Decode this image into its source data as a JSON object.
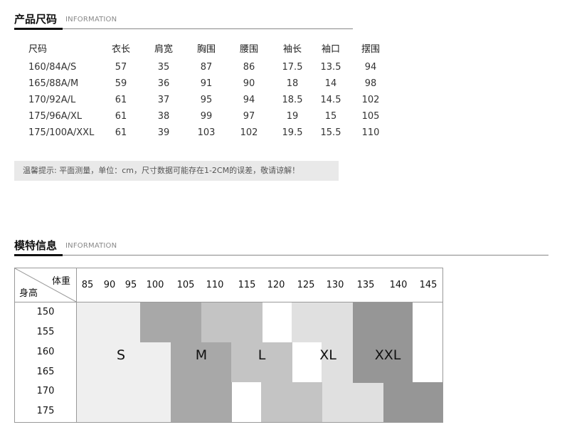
{
  "section1": {
    "title": "产品尺码",
    "subtitle": "INFORMATION"
  },
  "size_table": {
    "headers": [
      "尺码",
      "衣长",
      "肩宽",
      "胸围",
      "腰围",
      "袖长",
      "袖口",
      "摆围"
    ],
    "rows": [
      [
        "160/84A/S",
        "57",
        "35",
        "87",
        "86",
        "17.5",
        "13.5",
        "94"
      ],
      [
        "165/88A/M",
        "59",
        "36",
        "91",
        "90",
        "18",
        "14",
        "98"
      ],
      [
        "170/92A/L",
        "61",
        "37",
        "95",
        "94",
        "18.5",
        "14.5",
        "102"
      ],
      [
        "175/96A/XL",
        "61",
        "38",
        "99",
        "97",
        "19",
        "15",
        "105"
      ],
      [
        "175/100A/XXL",
        "61",
        "39",
        "103",
        "102",
        "19.5",
        "15.5",
        "110"
      ]
    ]
  },
  "note": "温馨提示: 平面测量，单位：cm，尺寸数据可能存在1-2CM的误差，敬请谅解！",
  "section2": {
    "title": "模特信息",
    "subtitle": "INFORMATION"
  },
  "model_grid": {
    "corner_weight": "体重",
    "corner_height": "身高",
    "weights": [
      "85",
      "90",
      "95",
      "100",
      "105",
      "110",
      "115",
      "120",
      "125",
      "130",
      "135",
      "140",
      "145"
    ],
    "heights": [
      "150",
      "155",
      "160",
      "165",
      "170",
      "175"
    ],
    "sizes": [
      "S",
      "M",
      "L",
      "XL",
      "XXL"
    ],
    "colors": {
      "S": "#efefef",
      "M": "#a8a8a8",
      "L": "#c4c4c4",
      "XL": "#e0e0e0",
      "XXL": "#969696"
    }
  }
}
